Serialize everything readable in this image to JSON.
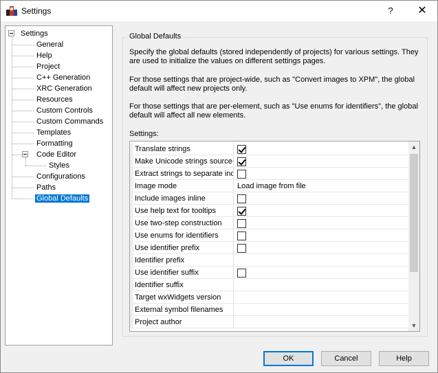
{
  "window": {
    "title": "Settings",
    "help_glyph": "?",
    "close_glyph": "✕"
  },
  "tree": {
    "root": "Settings",
    "items": [
      "General",
      "Help",
      "Project",
      "C++ Generation",
      "XRC Generation",
      "Resources",
      "Custom Controls",
      "Custom Commands",
      "Templates",
      "Formatting",
      "Code Editor",
      "Styles",
      "Configurations",
      "Paths",
      "Global Defaults"
    ],
    "selected": "Global Defaults"
  },
  "group": {
    "title": "Global Defaults",
    "desc1_line1": "Specify the global defaults (stored independently of projects) for various settings. They",
    "desc1_line2": "are used to initialize the values on different settings pages.",
    "desc2_line1": "For those settings that are project-wide, such as \"Convert images to XPM\", the global",
    "desc2_line2": "default will affect new projects only.",
    "desc3_line1": "For those settings that are per-element, such as \"Use enums for identifiers\", the global",
    "desc3_line2": "default will affect all new elements.",
    "settings_label": "Settings:"
  },
  "grid": {
    "rows": [
      {
        "name": "Translate strings",
        "type": "check",
        "checked": true
      },
      {
        "name": "Make Unicode strings source-f",
        "type": "check",
        "checked": true
      },
      {
        "name": "Extract strings to separate inc",
        "type": "check",
        "checked": false
      },
      {
        "name": "Image mode",
        "type": "text",
        "value": "Load image from file"
      },
      {
        "name": "Include images inline",
        "type": "check",
        "checked": false
      },
      {
        "name": "Use help text for tooltips",
        "type": "check",
        "checked": true
      },
      {
        "name": "Use two-step construction",
        "type": "check",
        "checked": false
      },
      {
        "name": "Use enums for identifiers",
        "type": "check",
        "checked": false
      },
      {
        "name": "Use identifier prefix",
        "type": "check",
        "checked": false
      },
      {
        "name": "Identifier prefix",
        "type": "text",
        "value": ""
      },
      {
        "name": "Use identifier suffix",
        "type": "check",
        "checked": false
      },
      {
        "name": "Identifier suffix",
        "type": "text",
        "value": ""
      },
      {
        "name": "Target wxWidgets version",
        "type": "text",
        "value": ""
      },
      {
        "name": "External symbol filenames",
        "type": "text",
        "value": ""
      },
      {
        "name": "Project author",
        "type": "text",
        "value": ""
      }
    ]
  },
  "buttons": {
    "ok": "OK",
    "cancel": "Cancel",
    "help": "Help"
  },
  "colors": {
    "selection": "#0078d7",
    "default_button_border": "#0078d7"
  }
}
